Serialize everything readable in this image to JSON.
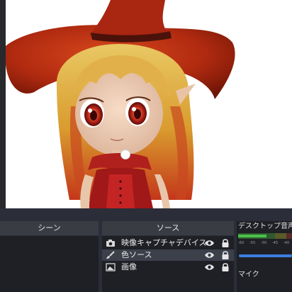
{
  "preview": {
    "canvas_background": "#ffffff",
    "subject": "3D chibi witch girl with red hat and blonde hair"
  },
  "scenes": {
    "title": "シーン"
  },
  "sources": {
    "title": "ソース",
    "items": [
      {
        "label": "映像キャプチャデバイス",
        "icon": "camera-icon",
        "visible": true,
        "locked": true,
        "selected": false
      },
      {
        "label": "色ソース",
        "icon": "brush-icon",
        "visible": true,
        "locked": true,
        "selected": true
      },
      {
        "label": "画像",
        "icon": "image-icon",
        "visible": true,
        "locked": true,
        "selected": false
      }
    ]
  },
  "mixer": {
    "desktop_audio_label": "デスクトップ音声",
    "ticks": [
      "-60",
      "-55",
      "-50",
      "-45",
      "-40"
    ],
    "second_channel_label": "マイク",
    "colors": {
      "low": "#4bc04b",
      "mid": "#cdd24a",
      "high": "#d04a4a",
      "volume": "#3d7de0"
    }
  }
}
